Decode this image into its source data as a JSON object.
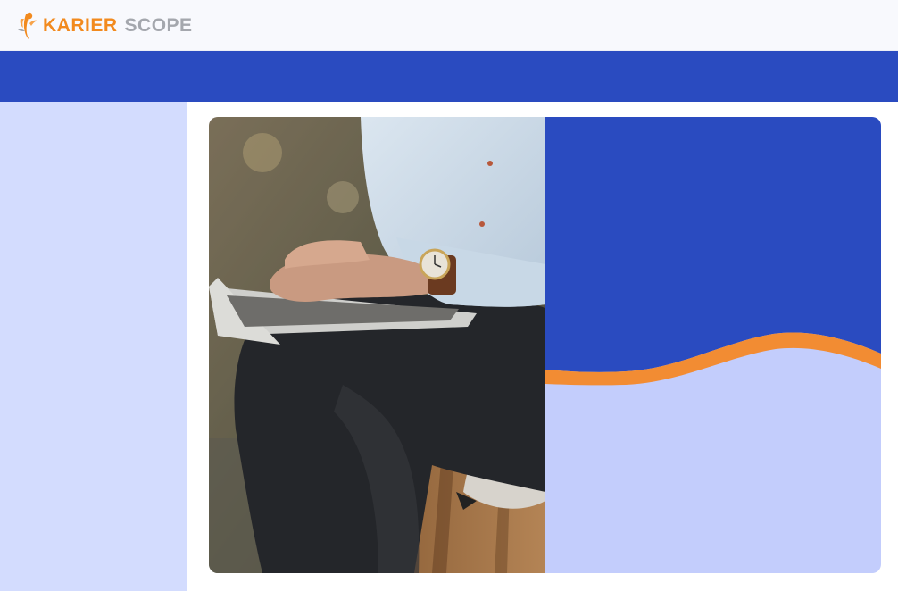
{
  "brand": {
    "name_part1": "KARIER",
    "name_part2": "SCOPE",
    "colors": {
      "orange": "#f28a1e",
      "gray": "#a4a7ad"
    }
  },
  "colors": {
    "primary_blue": "#2a4bc0",
    "sidebar_bg": "#d3dcfe",
    "hero_light": "#c3cdfc",
    "accent_orange": "#f28c33"
  }
}
